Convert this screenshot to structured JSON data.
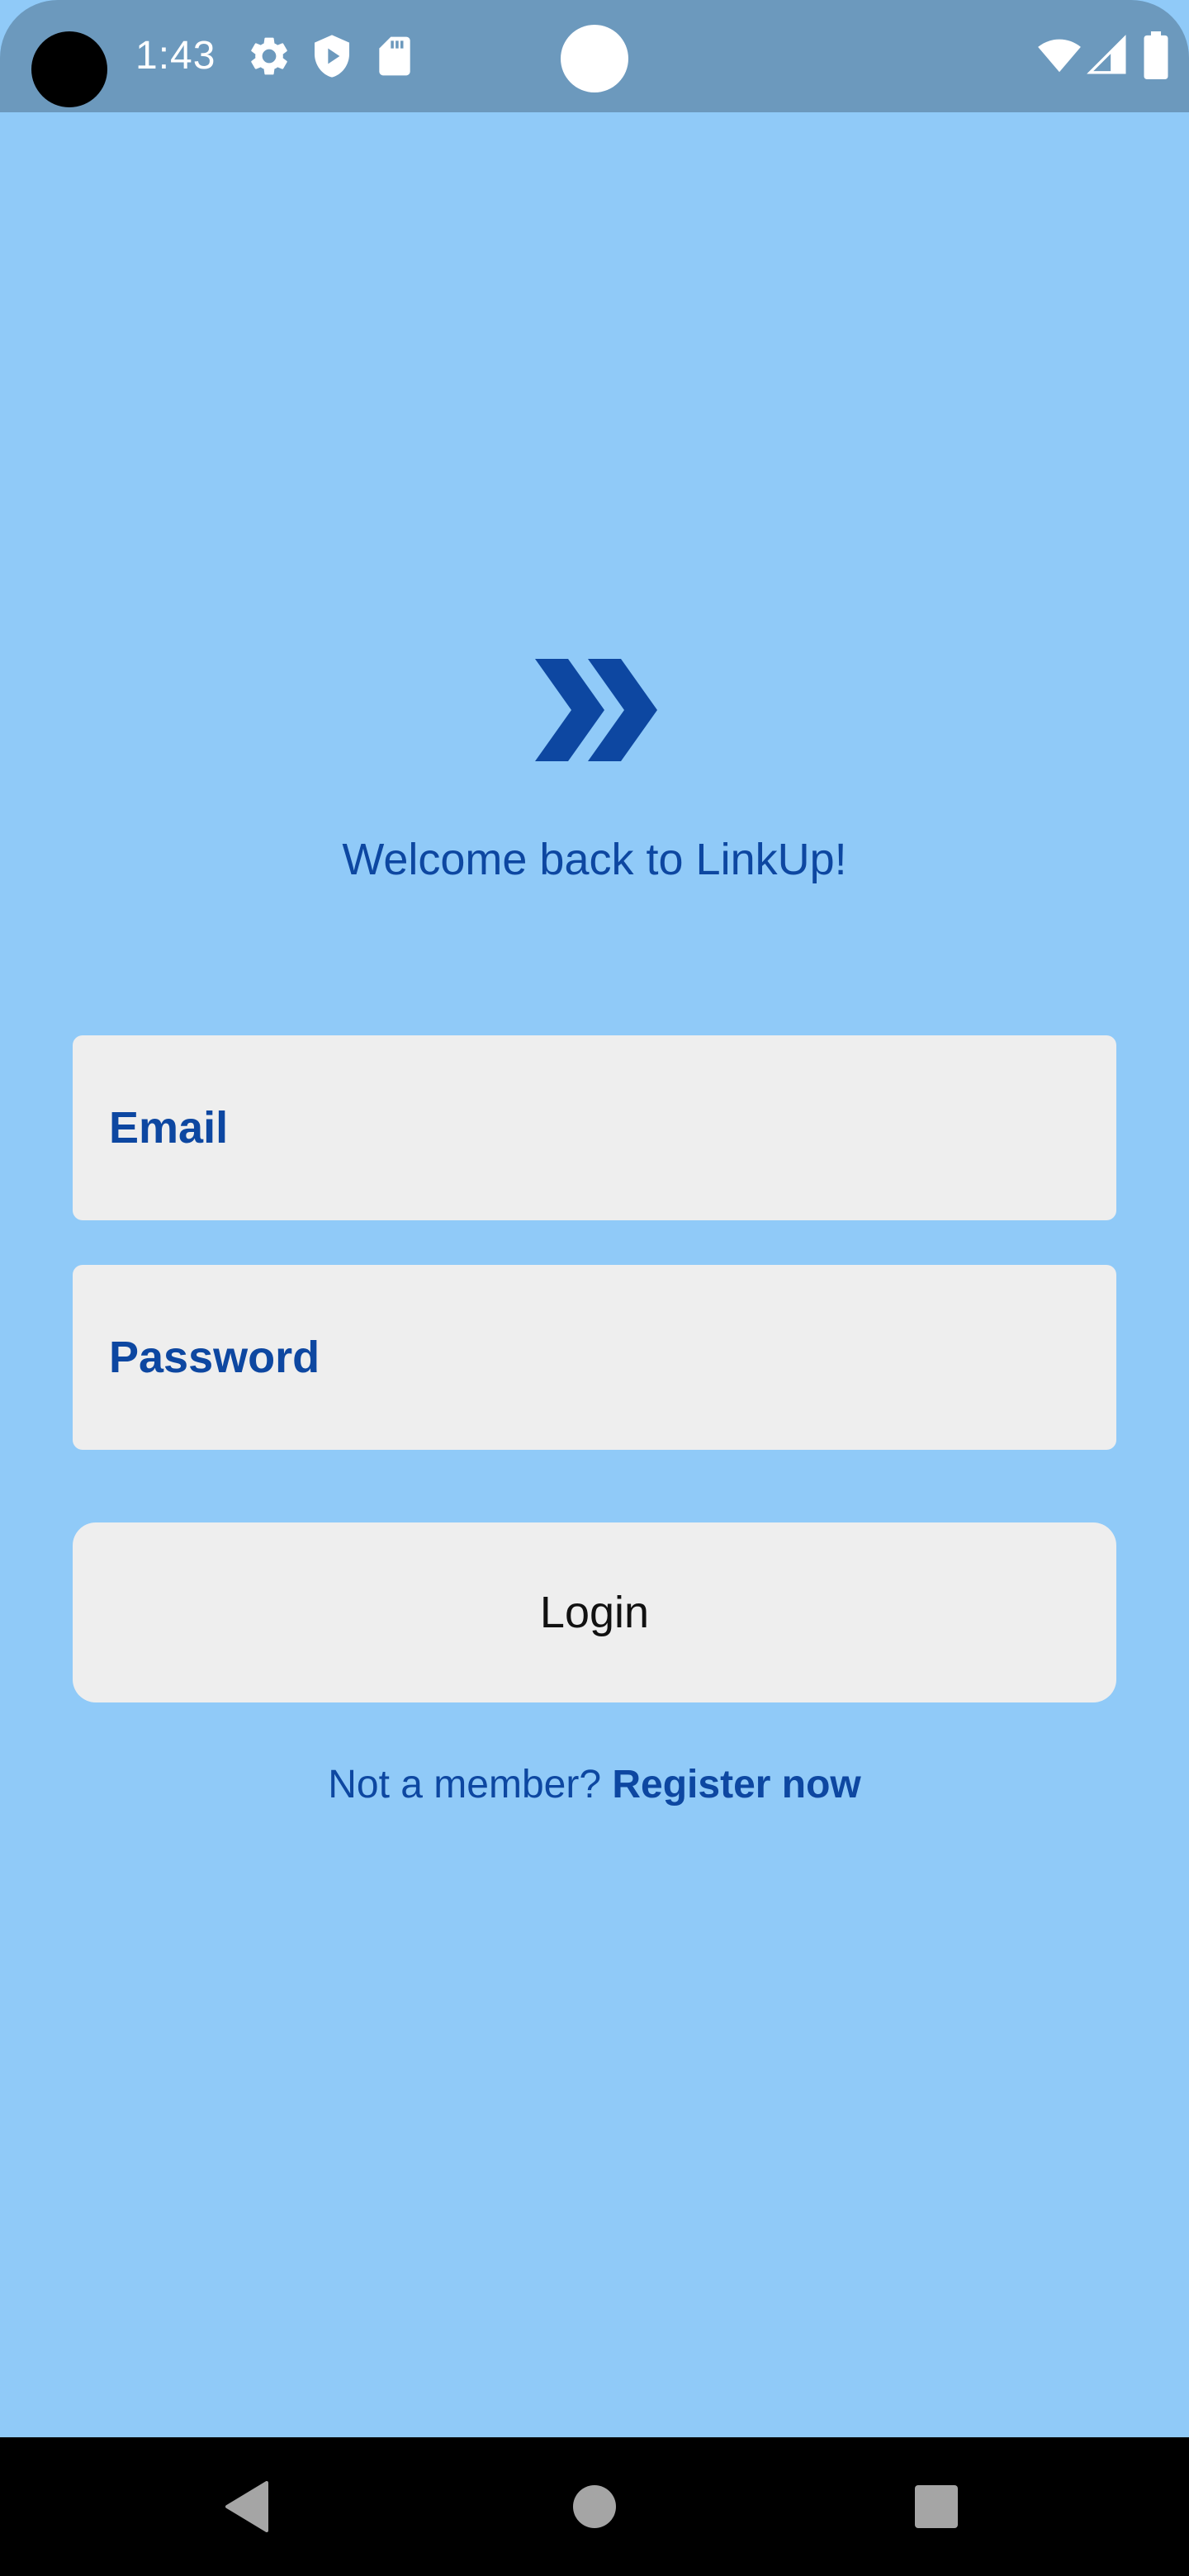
{
  "status_bar": {
    "time": "1:43",
    "left_icons": [
      "gear-icon",
      "shield-play-icon",
      "sd-card-icon"
    ],
    "right_icons": [
      "wifi-icon",
      "signal-icon",
      "battery-icon"
    ]
  },
  "login": {
    "logo_icon": "double-chevron-right-icon",
    "welcome_text": "Welcome back to LinkUp!",
    "email_placeholder": "Email",
    "password_placeholder": "Password",
    "login_label": "Login",
    "register_prompt": "Not a member? ",
    "register_link": "Register now"
  },
  "nav_bar": {
    "buttons": [
      "back",
      "home",
      "recents"
    ]
  },
  "colors": {
    "background": "#90caf8",
    "status_bar": "#6c99bd",
    "accent": "#0d47a1",
    "field_bg": "#eeeeee"
  }
}
